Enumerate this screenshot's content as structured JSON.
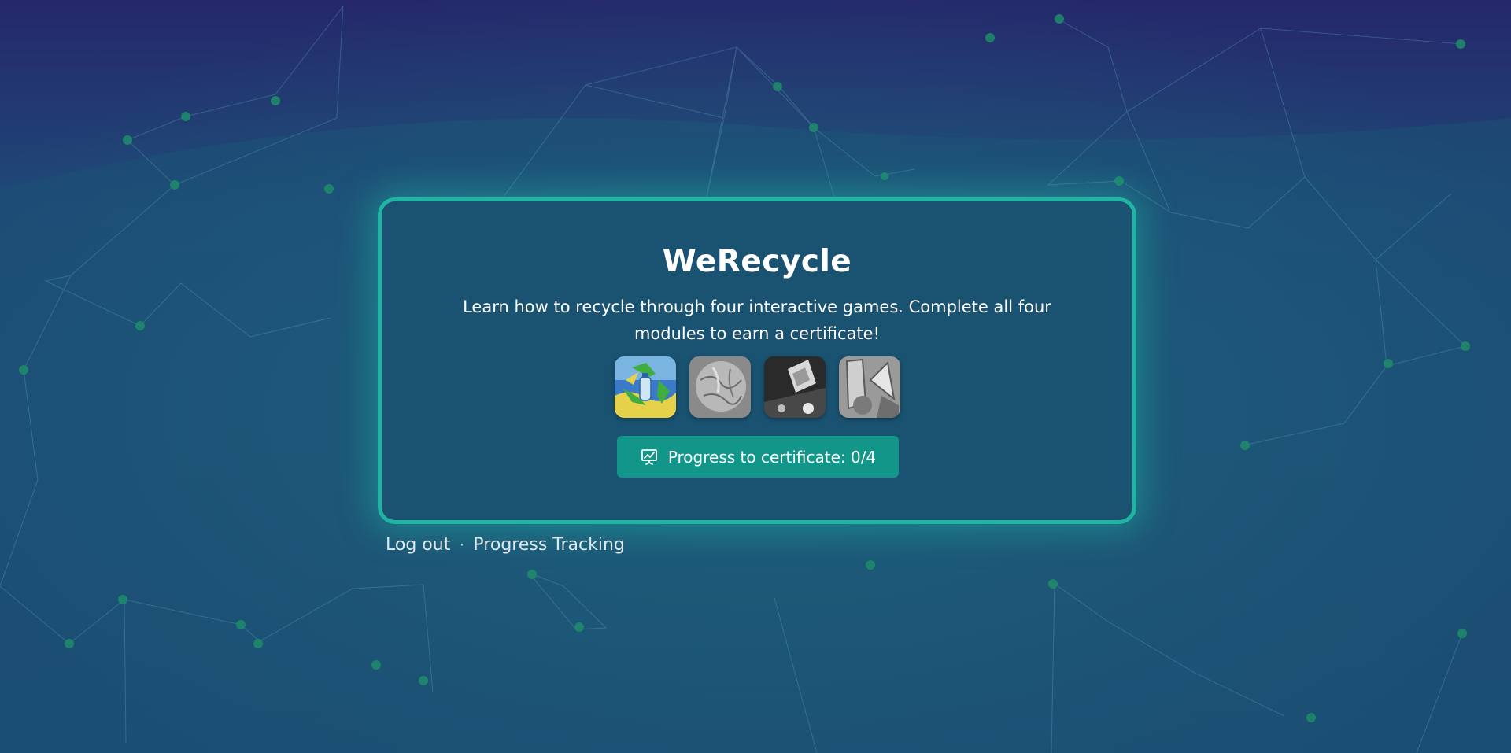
{
  "app": {
    "title": "WeRecycle",
    "description": "Learn how to recycle through four interactive games. Complete all four modules to earn a certificate!"
  },
  "modules": [
    {
      "icon": "recycling-bottle-icon"
    },
    {
      "icon": "crumpled-paper-icon"
    },
    {
      "icon": "trash-bin-icon"
    },
    {
      "icon": "glass-jar-icon"
    }
  ],
  "progress": {
    "label": "Progress to certificate: 0/4",
    "completed": 0,
    "total": 4,
    "icon": "chart-presentation-icon"
  },
  "footer": {
    "logout_label": "Log out",
    "separator": "·",
    "tracking_label": "Progress Tracking"
  },
  "colors": {
    "background_top": "#25286b",
    "background_bottom": "#1c4f72",
    "accent": "#1fb5a3",
    "button": "#12968a",
    "recycle_green": "#1f8c6a"
  }
}
